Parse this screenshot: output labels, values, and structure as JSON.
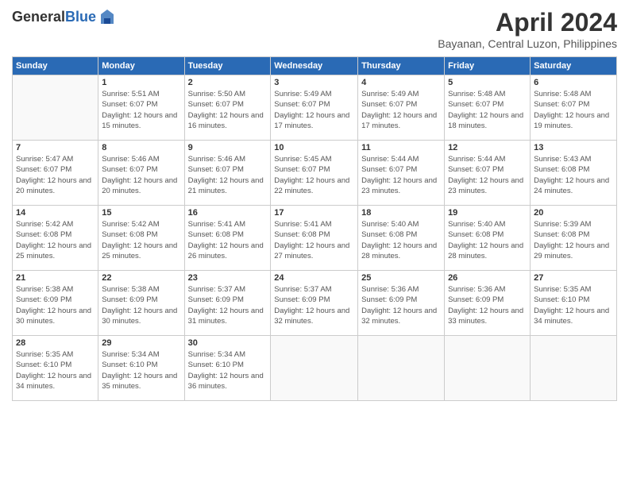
{
  "header": {
    "logo_general": "General",
    "logo_blue": "Blue",
    "title": "April 2024",
    "location": "Bayanan, Central Luzon, Philippines"
  },
  "columns": [
    "Sunday",
    "Monday",
    "Tuesday",
    "Wednesday",
    "Thursday",
    "Friday",
    "Saturday"
  ],
  "weeks": [
    [
      {
        "day": "",
        "sunrise": "",
        "sunset": "",
        "daylight": ""
      },
      {
        "day": "1",
        "sunrise": "Sunrise: 5:51 AM",
        "sunset": "Sunset: 6:07 PM",
        "daylight": "Daylight: 12 hours and 15 minutes."
      },
      {
        "day": "2",
        "sunrise": "Sunrise: 5:50 AM",
        "sunset": "Sunset: 6:07 PM",
        "daylight": "Daylight: 12 hours and 16 minutes."
      },
      {
        "day": "3",
        "sunrise": "Sunrise: 5:49 AM",
        "sunset": "Sunset: 6:07 PM",
        "daylight": "Daylight: 12 hours and 17 minutes."
      },
      {
        "day": "4",
        "sunrise": "Sunrise: 5:49 AM",
        "sunset": "Sunset: 6:07 PM",
        "daylight": "Daylight: 12 hours and 17 minutes."
      },
      {
        "day": "5",
        "sunrise": "Sunrise: 5:48 AM",
        "sunset": "Sunset: 6:07 PM",
        "daylight": "Daylight: 12 hours and 18 minutes."
      },
      {
        "day": "6",
        "sunrise": "Sunrise: 5:48 AM",
        "sunset": "Sunset: 6:07 PM",
        "daylight": "Daylight: 12 hours and 19 minutes."
      }
    ],
    [
      {
        "day": "7",
        "sunrise": "Sunrise: 5:47 AM",
        "sunset": "Sunset: 6:07 PM",
        "daylight": "Daylight: 12 hours and 20 minutes."
      },
      {
        "day": "8",
        "sunrise": "Sunrise: 5:46 AM",
        "sunset": "Sunset: 6:07 PM",
        "daylight": "Daylight: 12 hours and 20 minutes."
      },
      {
        "day": "9",
        "sunrise": "Sunrise: 5:46 AM",
        "sunset": "Sunset: 6:07 PM",
        "daylight": "Daylight: 12 hours and 21 minutes."
      },
      {
        "day": "10",
        "sunrise": "Sunrise: 5:45 AM",
        "sunset": "Sunset: 6:07 PM",
        "daylight": "Daylight: 12 hours and 22 minutes."
      },
      {
        "day": "11",
        "sunrise": "Sunrise: 5:44 AM",
        "sunset": "Sunset: 6:07 PM",
        "daylight": "Daylight: 12 hours and 23 minutes."
      },
      {
        "day": "12",
        "sunrise": "Sunrise: 5:44 AM",
        "sunset": "Sunset: 6:07 PM",
        "daylight": "Daylight: 12 hours and 23 minutes."
      },
      {
        "day": "13",
        "sunrise": "Sunrise: 5:43 AM",
        "sunset": "Sunset: 6:08 PM",
        "daylight": "Daylight: 12 hours and 24 minutes."
      }
    ],
    [
      {
        "day": "14",
        "sunrise": "Sunrise: 5:42 AM",
        "sunset": "Sunset: 6:08 PM",
        "daylight": "Daylight: 12 hours and 25 minutes."
      },
      {
        "day": "15",
        "sunrise": "Sunrise: 5:42 AM",
        "sunset": "Sunset: 6:08 PM",
        "daylight": "Daylight: 12 hours and 25 minutes."
      },
      {
        "day": "16",
        "sunrise": "Sunrise: 5:41 AM",
        "sunset": "Sunset: 6:08 PM",
        "daylight": "Daylight: 12 hours and 26 minutes."
      },
      {
        "day": "17",
        "sunrise": "Sunrise: 5:41 AM",
        "sunset": "Sunset: 6:08 PM",
        "daylight": "Daylight: 12 hours and 27 minutes."
      },
      {
        "day": "18",
        "sunrise": "Sunrise: 5:40 AM",
        "sunset": "Sunset: 6:08 PM",
        "daylight": "Daylight: 12 hours and 28 minutes."
      },
      {
        "day": "19",
        "sunrise": "Sunrise: 5:40 AM",
        "sunset": "Sunset: 6:08 PM",
        "daylight": "Daylight: 12 hours and 28 minutes."
      },
      {
        "day": "20",
        "sunrise": "Sunrise: 5:39 AM",
        "sunset": "Sunset: 6:08 PM",
        "daylight": "Daylight: 12 hours and 29 minutes."
      }
    ],
    [
      {
        "day": "21",
        "sunrise": "Sunrise: 5:38 AM",
        "sunset": "Sunset: 6:09 PM",
        "daylight": "Daylight: 12 hours and 30 minutes."
      },
      {
        "day": "22",
        "sunrise": "Sunrise: 5:38 AM",
        "sunset": "Sunset: 6:09 PM",
        "daylight": "Daylight: 12 hours and 30 minutes."
      },
      {
        "day": "23",
        "sunrise": "Sunrise: 5:37 AM",
        "sunset": "Sunset: 6:09 PM",
        "daylight": "Daylight: 12 hours and 31 minutes."
      },
      {
        "day": "24",
        "sunrise": "Sunrise: 5:37 AM",
        "sunset": "Sunset: 6:09 PM",
        "daylight": "Daylight: 12 hours and 32 minutes."
      },
      {
        "day": "25",
        "sunrise": "Sunrise: 5:36 AM",
        "sunset": "Sunset: 6:09 PM",
        "daylight": "Daylight: 12 hours and 32 minutes."
      },
      {
        "day": "26",
        "sunrise": "Sunrise: 5:36 AM",
        "sunset": "Sunset: 6:09 PM",
        "daylight": "Daylight: 12 hours and 33 minutes."
      },
      {
        "day": "27",
        "sunrise": "Sunrise: 5:35 AM",
        "sunset": "Sunset: 6:10 PM",
        "daylight": "Daylight: 12 hours and 34 minutes."
      }
    ],
    [
      {
        "day": "28",
        "sunrise": "Sunrise: 5:35 AM",
        "sunset": "Sunset: 6:10 PM",
        "daylight": "Daylight: 12 hours and 34 minutes."
      },
      {
        "day": "29",
        "sunrise": "Sunrise: 5:34 AM",
        "sunset": "Sunset: 6:10 PM",
        "daylight": "Daylight: 12 hours and 35 minutes."
      },
      {
        "day": "30",
        "sunrise": "Sunrise: 5:34 AM",
        "sunset": "Sunset: 6:10 PM",
        "daylight": "Daylight: 12 hours and 36 minutes."
      },
      {
        "day": "",
        "sunrise": "",
        "sunset": "",
        "daylight": ""
      },
      {
        "day": "",
        "sunrise": "",
        "sunset": "",
        "daylight": ""
      },
      {
        "day": "",
        "sunrise": "",
        "sunset": "",
        "daylight": ""
      },
      {
        "day": "",
        "sunrise": "",
        "sunset": "",
        "daylight": ""
      }
    ]
  ]
}
